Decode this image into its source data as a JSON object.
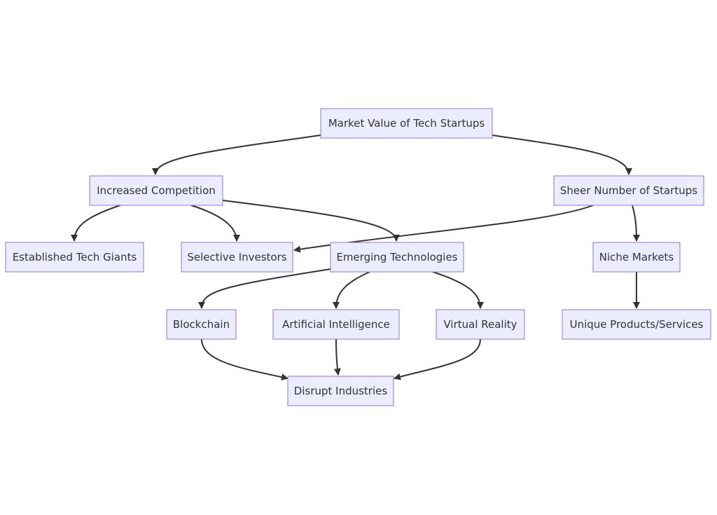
{
  "diagram": {
    "type": "flowchart",
    "direction": "top-down",
    "colors": {
      "node_fill": "#ECECFF",
      "node_stroke": "#9370DB",
      "text": "#333333",
      "edge": "#333333",
      "background": "#FFFFFF"
    },
    "nodes": [
      {
        "id": "market",
        "label": "Market Value of Tech Startups"
      },
      {
        "id": "competition",
        "label": "Increased Competition"
      },
      {
        "id": "sheer",
        "label": "Sheer Number of Startups"
      },
      {
        "id": "giants",
        "label": "Established Tech Giants"
      },
      {
        "id": "investors",
        "label": "Selective Investors"
      },
      {
        "id": "emerging",
        "label": "Emerging Technologies"
      },
      {
        "id": "niche",
        "label": "Niche Markets"
      },
      {
        "id": "blockchain",
        "label": "Blockchain"
      },
      {
        "id": "ai",
        "label": "Artificial Intelligence"
      },
      {
        "id": "vr",
        "label": "Virtual Reality"
      },
      {
        "id": "unique",
        "label": "Unique Products/Services"
      },
      {
        "id": "disrupt",
        "label": "Disrupt Industries"
      }
    ],
    "edges": [
      {
        "from": "market",
        "to": "competition"
      },
      {
        "from": "market",
        "to": "sheer"
      },
      {
        "from": "competition",
        "to": "giants"
      },
      {
        "from": "competition",
        "to": "investors"
      },
      {
        "from": "competition",
        "to": "emerging"
      },
      {
        "from": "sheer",
        "to": "investors"
      },
      {
        "from": "sheer",
        "to": "niche"
      },
      {
        "from": "emerging",
        "to": "blockchain"
      },
      {
        "from": "emerging",
        "to": "ai"
      },
      {
        "from": "emerging",
        "to": "vr"
      },
      {
        "from": "niche",
        "to": "unique"
      },
      {
        "from": "blockchain",
        "to": "disrupt"
      },
      {
        "from": "ai",
        "to": "disrupt"
      },
      {
        "from": "vr",
        "to": "disrupt"
      }
    ]
  }
}
